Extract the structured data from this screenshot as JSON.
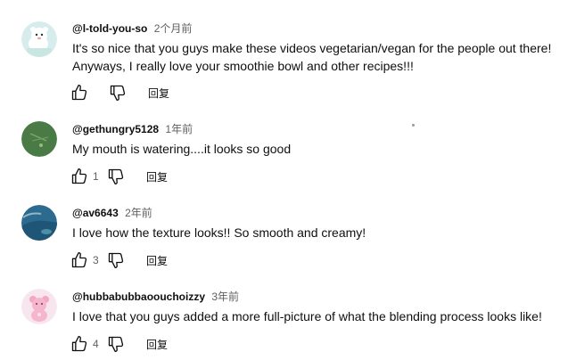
{
  "comments": [
    {
      "author": "@l-told-you-so",
      "time": "2个月前",
      "text_lines": [
        "It's so nice that you guys make these videos vegetarian/vegan for the people out there!",
        "Anyways, I really love your smoothie bowl and other recipes!!!"
      ],
      "likes": "",
      "reply_label": "回复",
      "avatar_icon": "cartoon-bear-avatar"
    },
    {
      "author": "@gethungry5128",
      "time": "1年前",
      "text_lines": [
        "My mouth is watering....it looks so good"
      ],
      "likes": "1",
      "reply_label": "回复",
      "avatar_icon": "green-logo-avatar"
    },
    {
      "author": "@av6643",
      "time": "2年前",
      "text_lines": [
        "I love how the texture looks!! So smooth and creamy!"
      ],
      "likes": "3",
      "reply_label": "回复",
      "avatar_icon": "ocean-photo-avatar"
    },
    {
      "author": "@hubbabubbaoouchoizzy",
      "time": "3年前",
      "text_lines": [
        "I love that you guys added a more full-picture of what the blending process looks like!"
      ],
      "likes": "4",
      "reply_label": "回复",
      "avatar_icon": "pink-bear-avatar"
    }
  ],
  "icons": {
    "like": "thumbs-up-icon",
    "dislike": "thumbs-down-icon"
  },
  "colors": {
    "text": "#0f0f0f",
    "secondary": "#606060"
  }
}
